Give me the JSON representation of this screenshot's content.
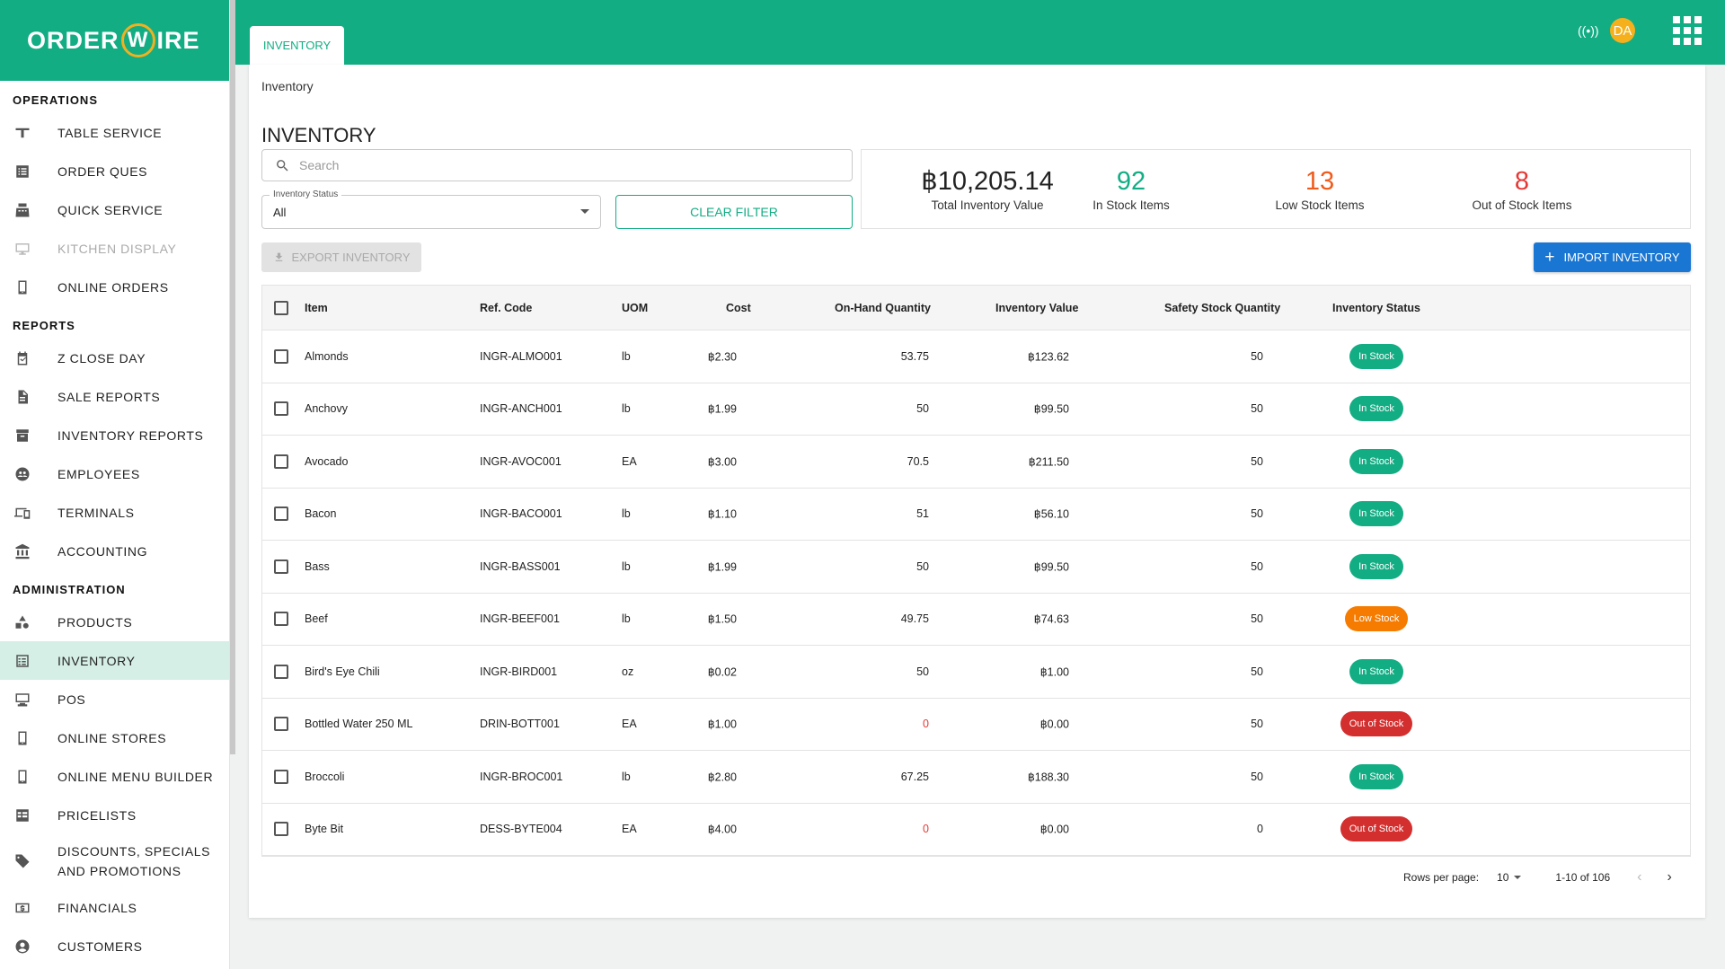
{
  "brand": {
    "logo_left": "ORDER",
    "logo_mid": "W",
    "logo_right": "IRE"
  },
  "sidebar": {
    "sections": [
      {
        "title": "OPERATIONS",
        "items": [
          {
            "label": "TABLE SERVICE",
            "icon": "table-icon"
          },
          {
            "label": "ORDER QUES",
            "icon": "list-icon"
          },
          {
            "label": "QUICK SERVICE",
            "icon": "register-icon"
          },
          {
            "label": "KITCHEN DISPLAY",
            "icon": "monitor-icon",
            "disabled": true
          },
          {
            "label": "ONLINE ORDERS",
            "icon": "tablet-icon"
          }
        ]
      },
      {
        "title": "REPORTS",
        "items": [
          {
            "label": "Z CLOSE DAY",
            "icon": "calendar-check-icon"
          },
          {
            "label": "SALE REPORTS",
            "icon": "document-icon"
          },
          {
            "label": "INVENTORY REPORTS",
            "icon": "archive-icon"
          },
          {
            "label": "EMPLOYEES",
            "icon": "people-icon"
          },
          {
            "label": "TERMINALS",
            "icon": "devices-icon"
          },
          {
            "label": "ACCOUNTING",
            "icon": "bank-icon"
          }
        ]
      },
      {
        "title": "ADMINISTRATION",
        "items": [
          {
            "label": "PRODUCTS",
            "icon": "shapes-icon"
          },
          {
            "label": "INVENTORY",
            "icon": "checklist-icon",
            "active": true
          },
          {
            "label": "POS",
            "icon": "pos-icon"
          },
          {
            "label": "ONLINE STORES",
            "icon": "tablet-icon"
          },
          {
            "label": "ONLINE MENU BUILDER",
            "icon": "tablet-icon"
          },
          {
            "label": "PRICELISTS",
            "icon": "pricelist-icon"
          },
          {
            "label": "DISCOUNTS, SPECIALS AND PROMOTIONS",
            "icon": "tag-icon",
            "tall": true
          },
          {
            "label": "FINANCIALS",
            "icon": "money-icon"
          },
          {
            "label": "CUSTOMERS",
            "icon": "account-icon"
          }
        ]
      }
    ]
  },
  "header": {
    "tab": "INVENTORY",
    "avatar": "DA"
  },
  "page": {
    "breadcrumb": "Inventory",
    "title": "INVENTORY",
    "search_placeholder": "Search",
    "status_label": "Inventory Status",
    "status_value": "All",
    "clear_filter": "CLEAR FILTER",
    "export": "EXPORT INVENTORY",
    "import": "IMPORT INVENTORY"
  },
  "stats": {
    "total_value": "฿10,205.14",
    "total_label": "Total Inventory Value",
    "in_stock": "92",
    "in_stock_label": "In Stock Items",
    "low_stock": "13",
    "low_stock_label": "Low Stock Items",
    "out_stock": "8",
    "out_stock_label": "Out of Stock Items",
    "colors": {
      "in": "#13ad84",
      "low": "#f05a1a",
      "out": "#e53935"
    }
  },
  "table": {
    "columns": [
      "Item",
      "Ref. Code",
      "UOM",
      "Cost",
      "On-Hand Quantity",
      "Inventory Value",
      "Safety Stock Quantity",
      "Inventory Status"
    ],
    "rows": [
      {
        "item": "Almonds",
        "ref": "INGR-ALMO001",
        "uom": "lb",
        "cost": "฿2.30",
        "qty": "53.75",
        "value": "฿123.62",
        "safety": "50",
        "status": "In Stock",
        "kind": "in"
      },
      {
        "item": "Anchovy",
        "ref": "INGR-ANCH001",
        "uom": "lb",
        "cost": "฿1.99",
        "qty": "50",
        "value": "฿99.50",
        "safety": "50",
        "status": "In Stock",
        "kind": "in"
      },
      {
        "item": "Avocado",
        "ref": "INGR-AVOC001",
        "uom": "EA",
        "cost": "฿3.00",
        "qty": "70.5",
        "value": "฿211.50",
        "safety": "50",
        "status": "In Stock",
        "kind": "in"
      },
      {
        "item": "Bacon",
        "ref": "INGR-BACO001",
        "uom": "lb",
        "cost": "฿1.10",
        "qty": "51",
        "value": "฿56.10",
        "safety": "50",
        "status": "In Stock",
        "kind": "in"
      },
      {
        "item": "Bass",
        "ref": "INGR-BASS001",
        "uom": "lb",
        "cost": "฿1.99",
        "qty": "50",
        "value": "฿99.50",
        "safety": "50",
        "status": "In Stock",
        "kind": "in"
      },
      {
        "item": "Beef",
        "ref": "INGR-BEEF001",
        "uom": "lb",
        "cost": "฿1.50",
        "qty": "49.75",
        "value": "฿74.63",
        "safety": "50",
        "status": "Low Stock",
        "kind": "low"
      },
      {
        "item": "Bird's Eye Chili",
        "ref": "INGR-BIRD001",
        "uom": "oz",
        "cost": "฿0.02",
        "qty": "50",
        "value": "฿1.00",
        "safety": "50",
        "status": "In Stock",
        "kind": "in"
      },
      {
        "item": "Bottled Water 250 ML",
        "ref": "DRIN-BOTT001",
        "uom": "EA",
        "cost": "฿1.00",
        "qty": "0",
        "value": "฿0.00",
        "safety": "50",
        "status": "Out of Stock",
        "kind": "out"
      },
      {
        "item": "Broccoli",
        "ref": "INGR-BROC001",
        "uom": "lb",
        "cost": "฿2.80",
        "qty": "67.25",
        "value": "฿188.30",
        "safety": "50",
        "status": "In Stock",
        "kind": "in"
      },
      {
        "item": "Byte Bit",
        "ref": "DESS-BYTE004",
        "uom": "EA",
        "cost": "฿4.00",
        "qty": "0",
        "value": "฿0.00",
        "safety": "0",
        "status": "Out of Stock",
        "kind": "out"
      }
    ]
  },
  "pagination": {
    "rows_label": "Rows per page:",
    "rows_value": "10",
    "range": "1-10 of 106"
  }
}
